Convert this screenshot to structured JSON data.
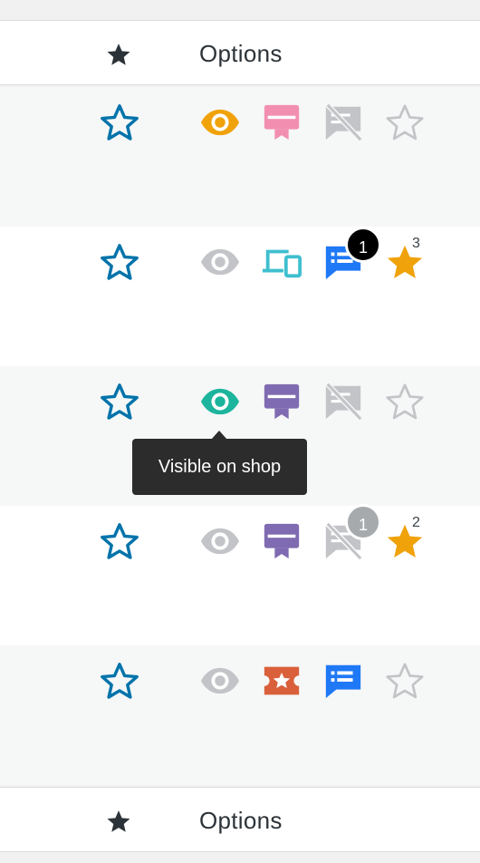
{
  "header": {
    "star_icon": "filled-star-icon",
    "options_label": "Options"
  },
  "footer": {
    "star_icon": "filled-star-icon",
    "options_label": "Options"
  },
  "colors": {
    "favorite_blue": "#0073aa",
    "visible_orange": "#f0a20b",
    "visible_green": "#1cb49c",
    "hidden_grey": "#c3c4c7",
    "voucher_pink": "#f28fb1",
    "voucher_purple": "#7f6bb1",
    "device_cyan": "#3fbfcf",
    "ticket_red": "#d9603b",
    "note_blue": "#1f78f5",
    "featured_orange": "#f0a20b"
  },
  "rows": [
    {
      "visibility": "visible",
      "product_type": "gift-card-icon",
      "notes": "no-notes-icon",
      "featured": false,
      "notes_badge": "",
      "featured_count": ""
    },
    {
      "visibility": "hidden",
      "product_type": "devices-icon",
      "notes": "notes-icon",
      "featured": true,
      "notes_badge": "1",
      "featured_count": "3"
    },
    {
      "visibility": "visible",
      "product_type": "gift-card-icon",
      "notes": "no-notes-icon",
      "featured": false,
      "notes_badge": "",
      "featured_count": ""
    },
    {
      "visibility": "hidden",
      "product_type": "gift-card-icon",
      "notes": "no-notes-icon",
      "featured": true,
      "notes_badge": "1",
      "featured_count": "2"
    },
    {
      "visibility": "hidden",
      "product_type": "ticket-icon",
      "notes": "notes-icon",
      "featured": false,
      "notes_badge": "",
      "featured_count": ""
    }
  ],
  "tooltip": {
    "text": "Visible on shop"
  }
}
